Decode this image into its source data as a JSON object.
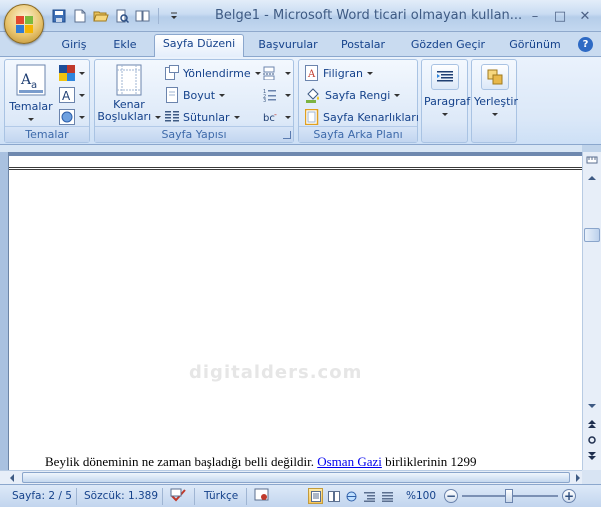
{
  "window": {
    "title": "Belge1 - Microsoft Word ticari olmayan kullan...",
    "controls": {
      "minimize": "–",
      "maximize": "□",
      "close": "✕"
    }
  },
  "quick_access": [
    "save-icon",
    "new-document-icon",
    "open-folder-icon",
    "print-preview-icon",
    "zoom-icon",
    "customize-arrow"
  ],
  "tabs": [
    {
      "label": "Giriş"
    },
    {
      "label": "Ekle"
    },
    {
      "label": "Sayfa Düzeni",
      "active": true
    },
    {
      "label": "Başvurular"
    },
    {
      "label": "Postalar"
    },
    {
      "label": "Gözden Geçir"
    },
    {
      "label": "Görünüm"
    }
  ],
  "help_label": "?",
  "ribbon": {
    "temalar": {
      "group_label": "Temalar",
      "themes_button": "Temalar"
    },
    "sayfa_yapisi": {
      "group_label": "Sayfa Yapısı",
      "margins_line1": "Kenar",
      "margins_line2": "Boşlukları",
      "orientation": "Yönlendirme",
      "size": "Boyut",
      "columns": "Sütunlar"
    },
    "sayfa_arka_plani": {
      "group_label": "Sayfa Arka Planı",
      "watermark": "Filigran",
      "page_color": "Sayfa Rengi",
      "page_borders": "Sayfa Kenarlıkları"
    },
    "paragraph": {
      "label": "Paragraf"
    },
    "arrange": {
      "label": "Yerleştir"
    }
  },
  "document": {
    "watermark_text": "digitalders.com",
    "text_before_link": "Beylik döneminin ne zaman başladığı belli değildir. ",
    "link_text": "Osman Gazi",
    "text_after_link": " birliklerinin  1299"
  },
  "status": {
    "page": "Sayfa: 2 / 5",
    "words": "Sözcük: 1.389",
    "language": "Türkçe",
    "zoom": "%100",
    "zoom_level_percent": 100
  },
  "colors": {
    "accent": "#15428b",
    "ribbon_bg": "#dbe8f8",
    "link": "#0000ee"
  }
}
